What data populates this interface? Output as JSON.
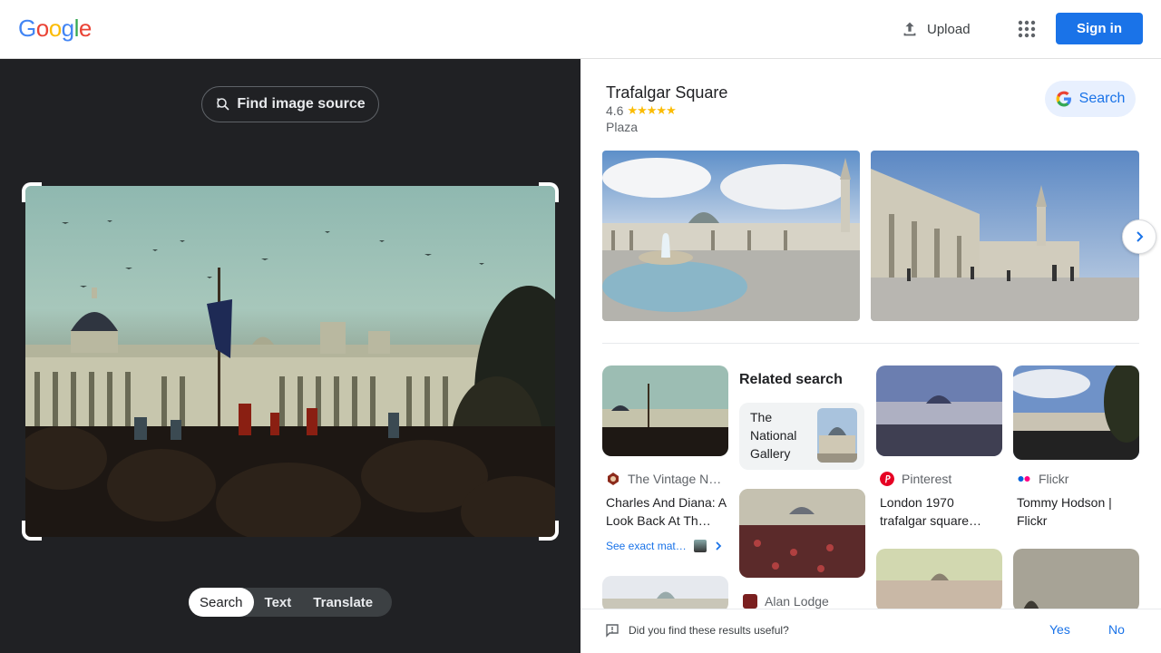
{
  "header": {
    "logo_letters": [
      "G",
      "o",
      "o",
      "g",
      "l",
      "e"
    ],
    "logo_colors": [
      "#4285f4",
      "#ea4335",
      "#fbbc05",
      "#4285f4",
      "#34a853",
      "#ea4335"
    ],
    "upload_label": "Upload",
    "apps_icon": "apps-grid-icon",
    "signin_label": "Sign in"
  },
  "left": {
    "find_source_label": "Find image source",
    "mode_tabs": [
      "Search",
      "Text",
      "Translate"
    ],
    "active_mode": "Search"
  },
  "result": {
    "title": "Trafalgar Square",
    "rating": "4.6",
    "stars": "★★★★★",
    "type": "Plaza",
    "search_button": "Search"
  },
  "matches": [
    {
      "source": "The Vintage N…",
      "title": "Charles And Diana: A Look Back At Th…",
      "exact_link": "See exact mat…"
    },
    {
      "source": "Pinterest",
      "title": "London 1970 trafalgar square…"
    },
    {
      "source": "Flickr",
      "title": "Tommy Hodson | Flickr"
    },
    {
      "source": "Alan Lodge"
    }
  ],
  "related": {
    "heading": "Related search",
    "item_label": "The National Gallery"
  },
  "feedback": {
    "question": "Did you find these results useful?",
    "yes": "Yes",
    "no": "No"
  },
  "colors": {
    "accent": "#1a73e8",
    "dark_panel": "#202124",
    "star": "#fbbc04",
    "pinterest": "#e60023"
  }
}
